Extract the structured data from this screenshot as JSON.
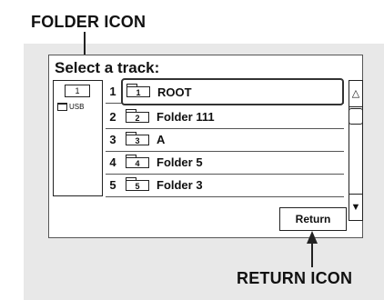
{
  "callouts": {
    "folder_icon": "FOLDER ICON",
    "return_icon": "RETURN ICON"
  },
  "screen": {
    "title": "Select a track:",
    "side": {
      "folder_icon_text": "1",
      "usb_label": "USB"
    },
    "tracks": [
      {
        "num": "1",
        "icon_text": "1",
        "label": "ROOT"
      },
      {
        "num": "2",
        "icon_text": "2",
        "label": "Folder 111"
      },
      {
        "num": "3",
        "icon_text": "3",
        "label": "A"
      },
      {
        "num": "4",
        "icon_text": "4",
        "label": "Folder 5"
      },
      {
        "num": "5",
        "icon_text": "5",
        "label": "Folder 3"
      }
    ],
    "scroll_up": "△",
    "scroll_down": "▼",
    "return_label": "Return"
  },
  "icons": [
    "folder-icon",
    "usb-icon",
    "scroll-up-icon",
    "scroll-down-icon"
  ]
}
